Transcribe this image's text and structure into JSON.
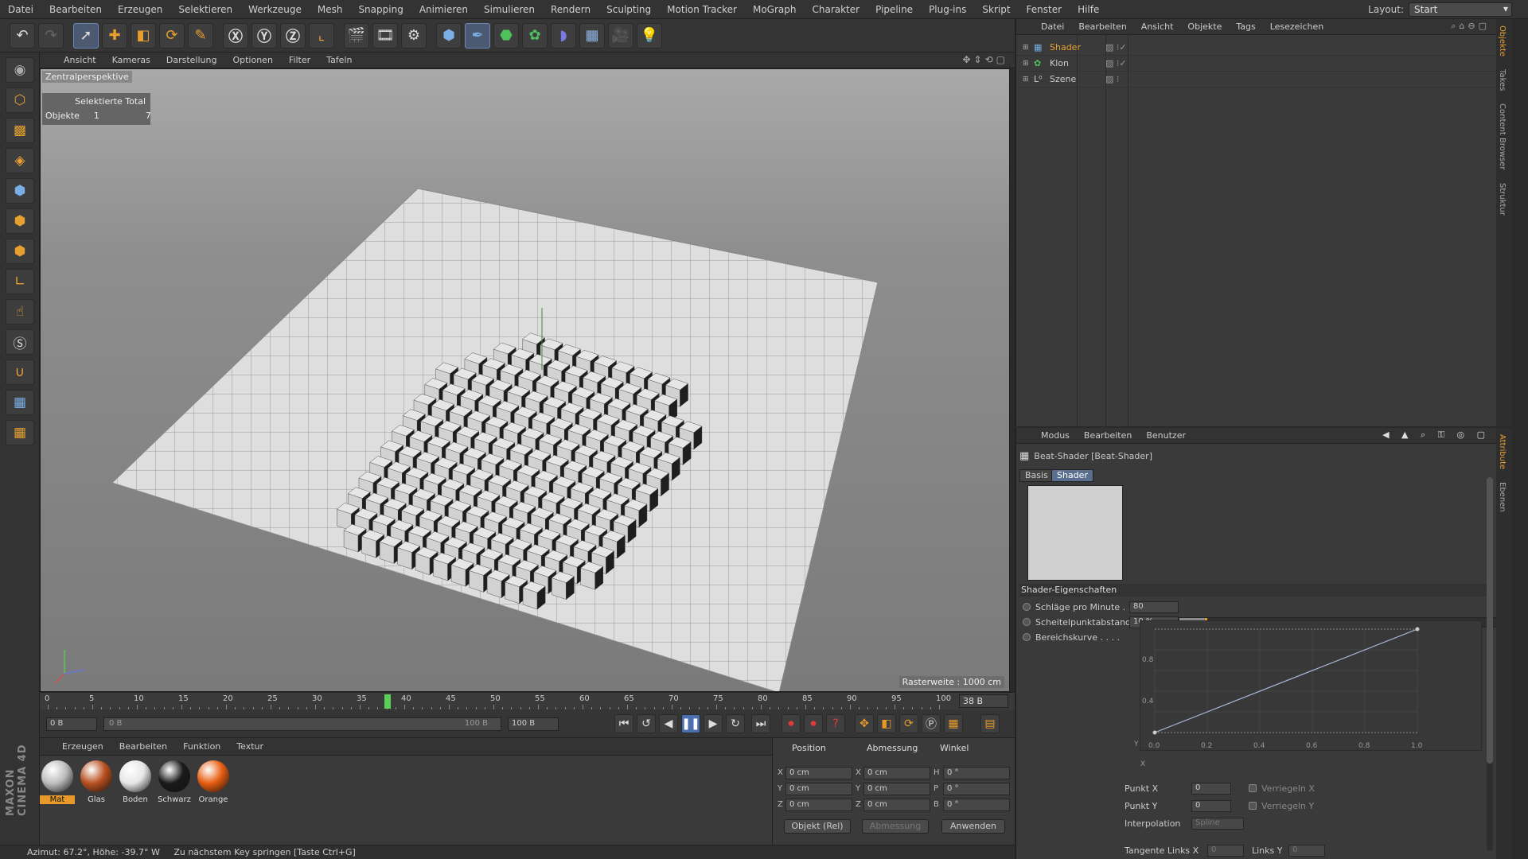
{
  "menu": [
    "Datei",
    "Bearbeiten",
    "Erzeugen",
    "Selektieren",
    "Werkzeuge",
    "Mesh",
    "Snapping",
    "Animieren",
    "Simulieren",
    "Rendern",
    "Sculpting",
    "Motion Tracker",
    "MoGraph",
    "Charakter",
    "Pipeline",
    "Plug-ins",
    "Skript",
    "Fenster",
    "Hilfe"
  ],
  "layout": {
    "label": "Layout:",
    "value": "Start"
  },
  "viewport": {
    "menu": [
      "Ansicht",
      "Kameras",
      "Darstellung",
      "Optionen",
      "Filter",
      "Tafeln"
    ],
    "perspective": "Zentralperspektive",
    "hud": {
      "header": "Selektierte Total",
      "row_label": "Objekte",
      "selected": "1",
      "total": "7"
    },
    "raster": "Rasterweite : 1000 cm"
  },
  "timeline": {
    "ticks": [
      "0",
      "5",
      "10",
      "15",
      "20",
      "25",
      "30",
      "35",
      "40",
      "45",
      "50",
      "55",
      "60",
      "65",
      "70",
      "75",
      "80",
      "85",
      "90",
      "95",
      "100"
    ],
    "current_frame": 38,
    "current_label": "38 B",
    "start": "0 B",
    "range_start": "0 B",
    "range_end": "100 B",
    "end": "100 B"
  },
  "materials": {
    "menu": [
      "Erzeugen",
      "Bearbeiten",
      "Funktion",
      "Textur"
    ],
    "items": [
      {
        "name": "Mat",
        "color": "#bdbdbd",
        "selected": true
      },
      {
        "name": "Glas",
        "color": "#b9501f",
        "selected": false
      },
      {
        "name": "Boden",
        "color": "#e6e6e6",
        "selected": false
      },
      {
        "name": "Schwarz",
        "color": "#1a1a1a",
        "selected": false
      },
      {
        "name": "Orange",
        "color": "#e85d10",
        "selected": false
      }
    ]
  },
  "coords": {
    "headers": [
      "Position",
      "Abmessung",
      "Winkel"
    ],
    "pos": [
      {
        "axis": "X",
        "value": "0 cm"
      },
      {
        "axis": "Y",
        "value": "0 cm"
      },
      {
        "axis": "Z",
        "value": "0 cm"
      }
    ],
    "size": [
      {
        "axis": "X",
        "value": "0 cm"
      },
      {
        "axis": "Y",
        "value": "0 cm"
      },
      {
        "axis": "Z",
        "value": "0 cm"
      }
    ],
    "angle": [
      {
        "axis": "H",
        "value": "0 °"
      },
      {
        "axis": "P",
        "value": "0 °"
      },
      {
        "axis": "B",
        "value": "0 °"
      }
    ],
    "mode": "Objekt (Rel)",
    "size_mode": "Abmessung",
    "apply": "Anwenden"
  },
  "status": {
    "left": "Azimut: 67.2°, Höhe: -39.7°  W",
    "hint": "Zu nächstem Key springen [Taste Ctrl+G]"
  },
  "objmgr": {
    "menu": [
      "Datei",
      "Bearbeiten",
      "Ansicht",
      "Objekte",
      "Tags",
      "Lesezeichen"
    ],
    "objects": [
      {
        "name": "Shader",
        "icon": "shader-icon",
        "selected": true
      },
      {
        "name": "Klon",
        "icon": "cloner-icon",
        "selected": false
      },
      {
        "name": "Szene",
        "icon": "scene-icon",
        "selected": false
      }
    ],
    "side_tabs": [
      "Objekte",
      "Takes",
      "Content Browser",
      "Struktur"
    ]
  },
  "attr": {
    "menu": [
      "Modus",
      "Bearbeiten",
      "Benutzer"
    ],
    "title": "Beat-Shader [Beat-Shader]",
    "tabs": [
      "Basis",
      "Shader"
    ],
    "section": "Shader-Eigenschaften",
    "beats_label": "Schläge pro Minute . .",
    "beats_value": "80",
    "peak_label": "Scheitelpunktabstand",
    "peak_value": "10 %",
    "peak_fraction": 0.1,
    "curve_label": "Bereichskurve . . . .",
    "graph": {
      "x_ticks": [
        "0.0",
        "0.2",
        "0.4",
        "0.6",
        "0.8",
        "1.0"
      ],
      "y_ticks": [
        "0.4",
        "0.8"
      ],
      "x_label": "X",
      "y_label": "Y"
    },
    "point_x_label": "Punkt X",
    "point_x": "0",
    "lock_x": "Verriegeln X",
    "point_y_label": "Punkt Y",
    "point_y": "0",
    "lock_y": "Verriegeln Y",
    "interp_label": "Interpolation",
    "interp": "Spline",
    "tangent_x_label": "Tangente Links X",
    "tangent_x": "0",
    "tangent_y_label": "Links Y",
    "tangent_y": "0",
    "side_tabs": [
      "Attribute",
      "Ebenen"
    ]
  },
  "colors": {
    "accent": "#e7a030",
    "playhead": "#58d058",
    "select": "#5a6e8e"
  }
}
